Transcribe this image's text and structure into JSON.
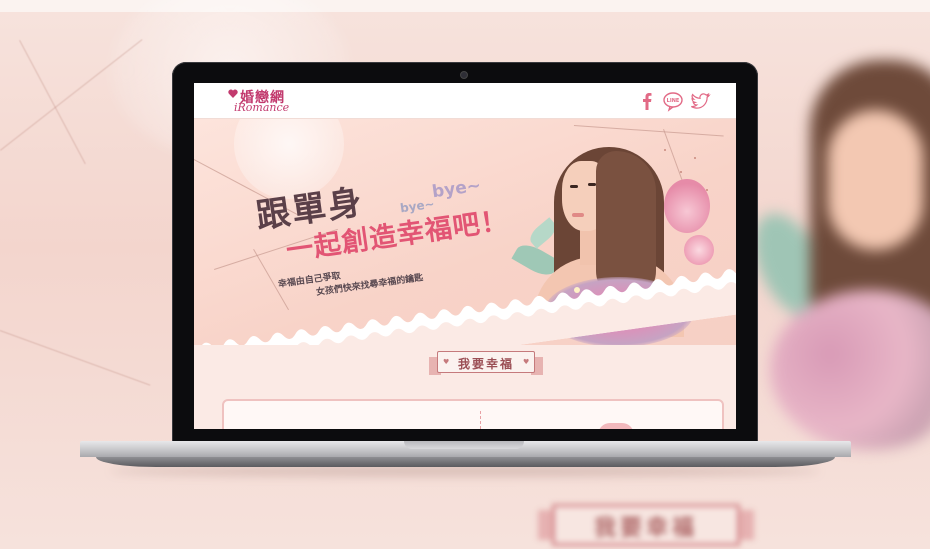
{
  "background": {
    "ribbon_text": "我要幸福"
  },
  "site": {
    "logo": {
      "chinese": "婚戀網",
      "english": "iRomance"
    },
    "social": {
      "facebook_icon": "facebook-icon",
      "line_icon": "line-icon",
      "line_text": "LINE",
      "twitter_icon": "twitter-icon"
    },
    "hero": {
      "headline_1": "跟單身",
      "headline_2": "一起創造幸福吧！",
      "bye_small": "bye~",
      "bye_big": "bye~",
      "subline_1": "幸福由自己爭取",
      "subline_2": "女孩們快來找尋幸福的鑰匙"
    },
    "section": {
      "ribbon_label": "我要幸福"
    }
  },
  "colors": {
    "brand": "#c23a6e",
    "headline_dark": "#5b4049",
    "headline_pink": "#e25574",
    "social_icon": "#e26a86",
    "ribbon_border": "#c57a7c"
  }
}
